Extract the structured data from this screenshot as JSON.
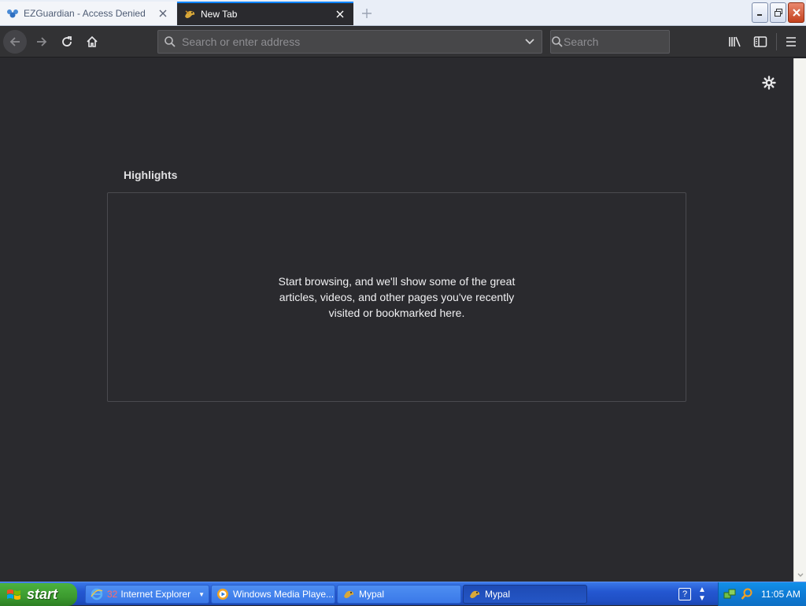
{
  "tabs": [
    {
      "title": "EZGuardian - Access Denied",
      "icon": "ezguardian-icon",
      "active": false
    },
    {
      "title": "New Tab",
      "icon": "mypal-icon",
      "active": true
    }
  ],
  "navbar": {
    "url_placeholder": "Search or enter address",
    "search_placeholder": "Search"
  },
  "content": {
    "highlights_title": "Highlights",
    "highlights_empty_text": "Start browsing, and we'll show some of the great articles, videos, and other pages you've recently visited or bookmarked here."
  },
  "taskbar": {
    "start_label": "start",
    "items": [
      {
        "label": "Internet Explorer",
        "count": "32",
        "icon": "internet-explorer-icon",
        "active": false
      },
      {
        "label": "Windows Media Playe...",
        "icon": "windows-media-player-icon",
        "active": false
      },
      {
        "label": "Mypal",
        "icon": "mypal-icon",
        "active": false
      },
      {
        "label": "Mypal",
        "icon": "mypal-icon",
        "active": true
      }
    ],
    "help_label": "?",
    "clock": "11:05 AM"
  },
  "colors": {
    "accent": "#0a84ff",
    "content_bg": "#2a2a2e",
    "toolbar_bg": "#323234",
    "taskbar_blue": "#2457d1",
    "start_green": "#3c9a2f"
  }
}
